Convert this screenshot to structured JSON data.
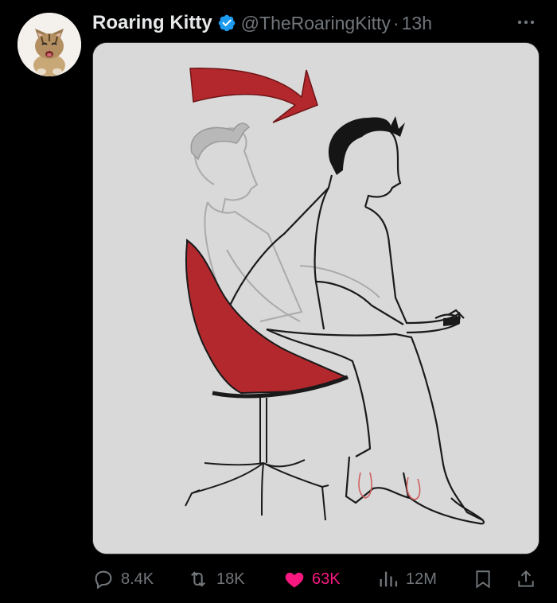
{
  "author": {
    "display_name": "Roaring Kitty",
    "handle": "@TheRoaringKitty",
    "separator": "·",
    "time": "13h",
    "avatar_icon": "kitten-avatar",
    "verified_icon": "verified-badge-icon",
    "verified_color": "#1d9bf0"
  },
  "media": {
    "type": "image",
    "subject": "drawing"
  },
  "actions": {
    "reply": {
      "icon": "reply-icon",
      "count": "8.4K"
    },
    "repost": {
      "icon": "repost-icon",
      "count": "18K"
    },
    "like": {
      "icon": "heart-icon",
      "count": "63K",
      "liked": true,
      "color": "#f91880"
    },
    "views": {
      "icon": "views-icon",
      "count": "12M"
    },
    "bookmark": {
      "icon": "bookmark-icon"
    },
    "share": {
      "icon": "share-icon"
    }
  },
  "colors": {
    "background": "#000000",
    "text_primary": "#e7e9ea",
    "text_secondary": "#71767b",
    "accent_red": "#b3282d"
  }
}
